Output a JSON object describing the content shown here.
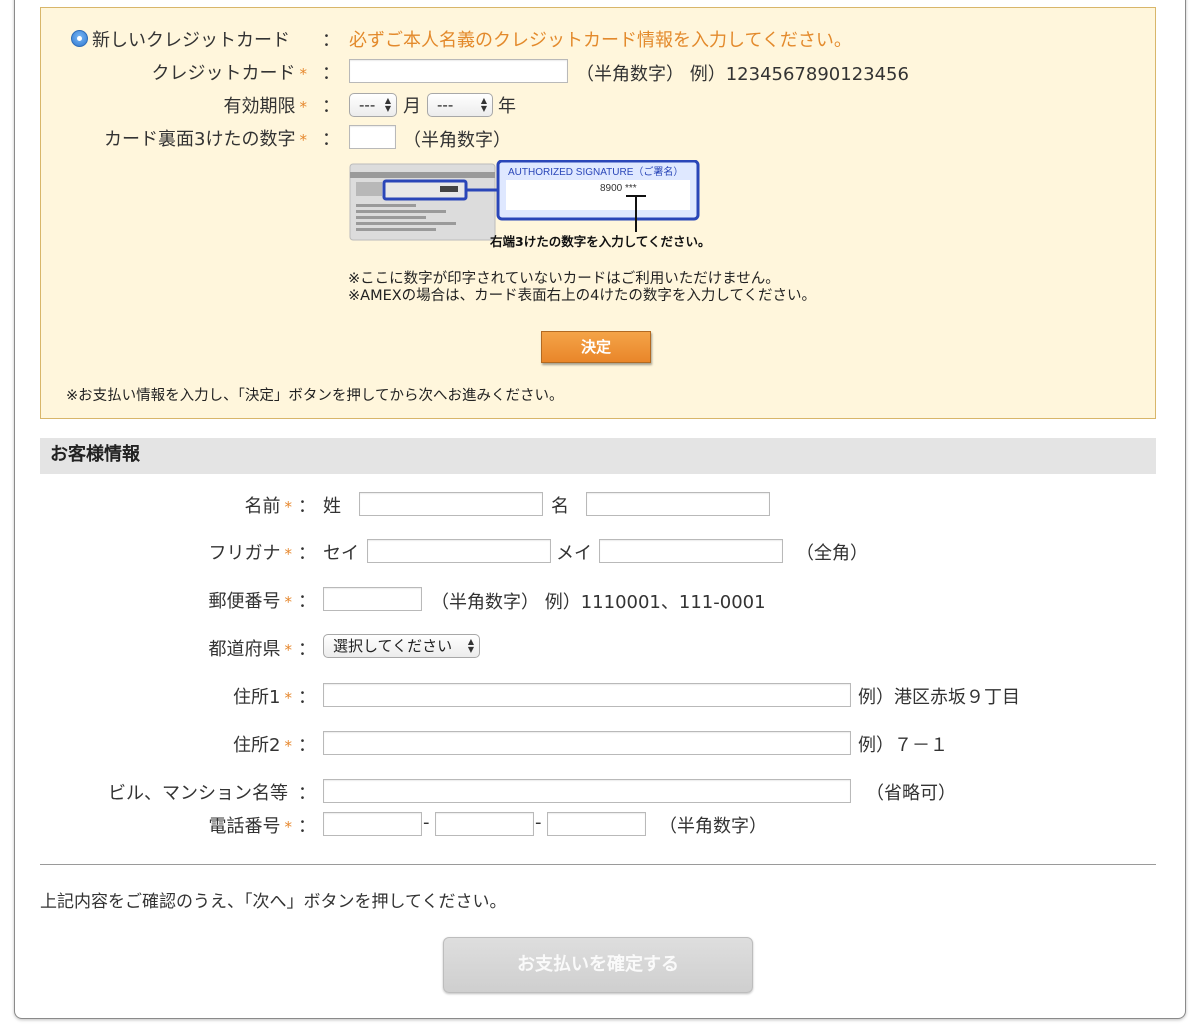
{
  "payment": {
    "new_card_label": "新しいクレジットカード",
    "new_card_notice": "必ずご本人名義のクレジットカード情報を入力してください。",
    "card_number_label": "クレジットカード",
    "card_number_hint": "（半角数字） 例）1234567890123456",
    "expiry_label": "有効期限",
    "expiry_month_value": "---",
    "expiry_month_unit": "月",
    "expiry_year_value": "---",
    "expiry_year_unit": "年",
    "cvv_label": "カード裏面3けたの数字",
    "cvv_hint": "（半角数字）",
    "card_image": {
      "signature_title": "AUTHORIZED SIGNATURE（ご署名）",
      "signature_digits": "8900 ***",
      "caption": "右端3けたの数字を入力してください。"
    },
    "note_line1": "※ここに数字が印字されていないカードはご利用いただけません。",
    "note_line2": "※AMEXの場合は、カード表面右上の4けたの数字を入力してください。",
    "decide_button": "決定",
    "bottom_note": "※お支払い情報を入力し、「決定」ボタンを押してから次へお進みください。"
  },
  "required_mark": "*",
  "colon": "：",
  "customer": {
    "section_title": "お客様情報",
    "name_label": "名前",
    "last_name_label": "姓",
    "first_name_label": "名",
    "kana_label": "フリガナ",
    "kana_last_label": "セイ",
    "kana_first_label": "メイ",
    "kana_hint": "（全角）",
    "zip_label": "郵便番号",
    "zip_hint": "（半角数字） 例）1110001、111-0001",
    "pref_label": "都道府県",
    "pref_select_value": "選択してください",
    "address1_label": "住所1",
    "address1_hint": "例）港区赤坂９丁目",
    "address2_label": "住所2",
    "address2_hint": "例）７－１",
    "building_label": "ビル、マンション名等",
    "building_hint": "（省略可）",
    "phone_label": "電話番号",
    "phone_sep": "-",
    "phone_hint": "（半角数字）"
  },
  "footer": {
    "confirm_note": "上記内容をご確認のうえ、「次へ」ボタンを押してください。",
    "confirm_button": "お支払いを確定する"
  },
  "colors": {
    "accent_orange": "#e6882f",
    "payment_bg": "#fff6dc",
    "section_bg": "#e4e4e4"
  }
}
